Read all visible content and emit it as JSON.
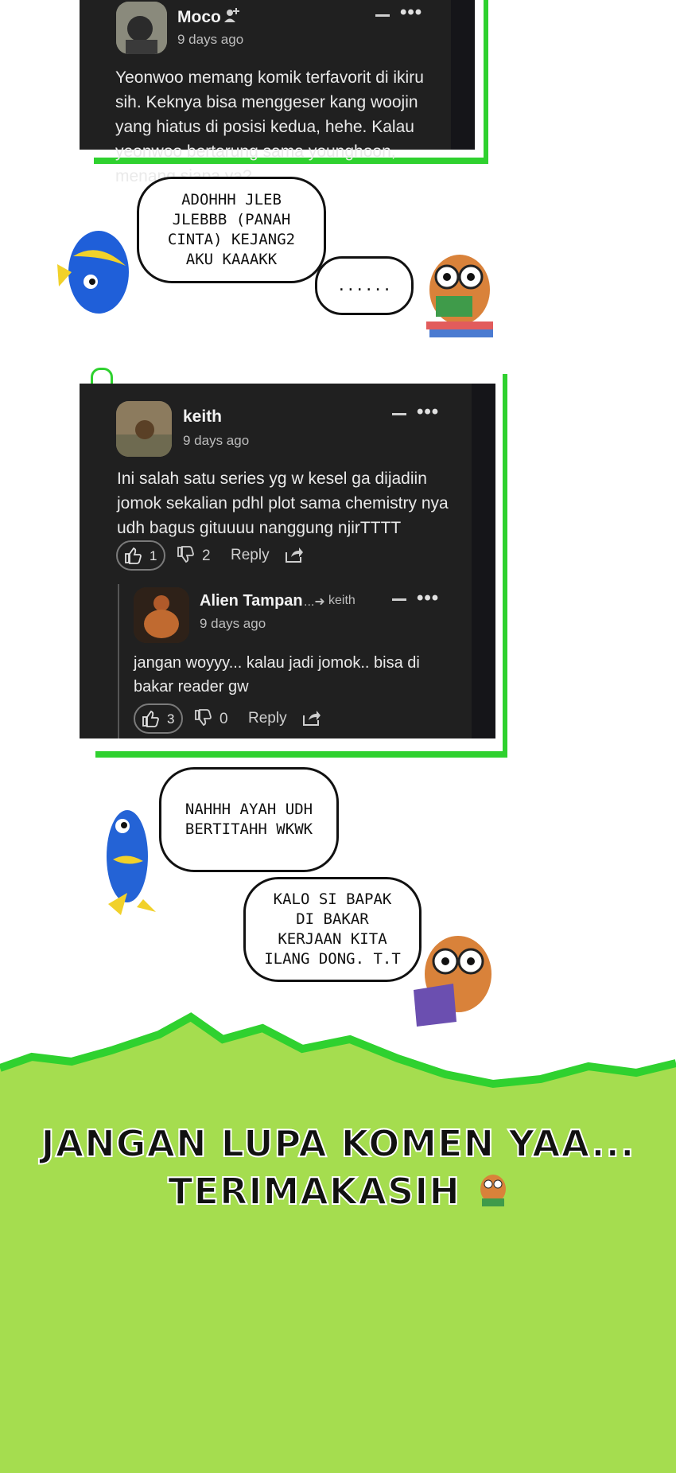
{
  "comment1": {
    "author": "Moco",
    "time": "9 days ago",
    "body": "Yeonwoo memang komik terfavorit di ikiru sih. Keknya bisa menggeser kang woojin yang hiatus di posisi kedua, hehe. Kalau yeonwoo bertarung sama younghoon, menang siapa ya?"
  },
  "bubbles1": {
    "fish": "ADOHHH JLEB JLEBBB (PANAH CINTA) KEJANG2 AKU KAAAKK",
    "owl": "......"
  },
  "comment2": {
    "author": "keith",
    "time": "9 days ago",
    "body": "Ini salah satu series yg w kesel ga dijadiin jomok sekalian pdhl plot sama chemistry nya udh bagus gituuuu nanggung njirTTTT",
    "likes": "1",
    "dislikes": "2",
    "reply_label": "Reply",
    "reply": {
      "author": "Alien Tampan",
      "reply_to": "keith",
      "time": "9 days ago",
      "body": "jangan woyyy... kalau jadi jomok.. bisa di bakar reader gw",
      "likes": "3",
      "dislikes": "0",
      "reply_label": "Reply"
    }
  },
  "bubbles2": {
    "fish": "NAHHH AYAH UDH BERTITAHH WKWK",
    "owl": "KALO SI BAPAK DI BAKAR KERJAAN KITA ILANG DONG. T.T"
  },
  "banner": {
    "line1": "JANGAN LUPA KOMEN YAA...",
    "line2": "TERIMAKASIH"
  },
  "colors": {
    "accent_green": "#2fd12f",
    "card_bg": "#202020",
    "banner_green": "#a5dd4f"
  },
  "icons": [
    "add-user-icon",
    "thumbs-up-icon",
    "thumbs-down-icon",
    "share-icon",
    "reply-arrow-icon",
    "more-dots-icon",
    "collapse-dash-icon"
  ]
}
